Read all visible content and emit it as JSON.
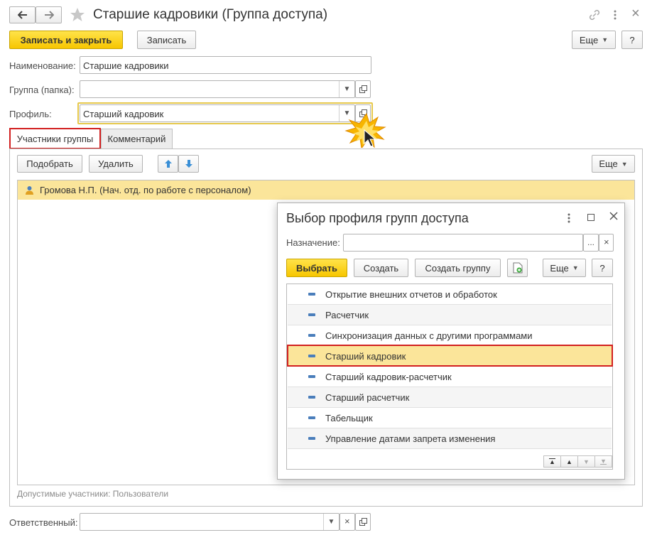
{
  "window": {
    "title": "Старшие кадровики (Группа доступа)",
    "back_icon": "arrow-left-icon",
    "forward_icon": "arrow-right-icon",
    "star_icon": "star-icon",
    "link_icon": "link-icon",
    "more_icon": "more-vertical-icon",
    "close_glyph": "×"
  },
  "toolbar": {
    "save_close_label": "Записать и закрыть",
    "save_label": "Записать",
    "more_label": "Еще",
    "help_label": "?"
  },
  "form": {
    "name_label": "Наименование:",
    "name_value": "Старшие кадровики",
    "group_label": "Группа (папка):",
    "group_value": "",
    "profile_label": "Профиль:",
    "profile_value": "Старший кадровик",
    "responsible_label": "Ответственный:",
    "responsible_value": ""
  },
  "tabs": {
    "members": "Участники группы",
    "comment": "Комментарий"
  },
  "members_panel": {
    "pick_label": "Подобрать",
    "delete_label": "Удалить",
    "more_label": "Еще",
    "rows": [
      "Громова Н.П. (Нач. отд. по работе с персоналом)"
    ],
    "footer_note": "Допустимые участники: Пользователи"
  },
  "dialog": {
    "title": "Выбор профиля групп доступа",
    "purpose_label": "Назначение:",
    "purpose_value": "",
    "ellipsis": "...",
    "clear": "×",
    "select_label": "Выбрать",
    "create_label": "Создать",
    "create_group_label": "Создать группу",
    "more_label": "Еще",
    "help_label": "?",
    "items": [
      "Открытие внешних отчетов и обработок",
      "Расчетчик",
      "Синхронизация данных с другими программами",
      "Старший кадровик",
      "Старший кадровик-расчетчик",
      "Старший расчетчик",
      "Табельщик",
      "Управление датами запрета изменения"
    ],
    "selected_index": 3
  },
  "colors": {
    "accent_yellow": "#f7c600",
    "selection_bg": "#fbe59a",
    "highlight_red": "#d21f1f",
    "focus_border": "#e6c84b",
    "icon_blue": "#4a7ebb"
  }
}
